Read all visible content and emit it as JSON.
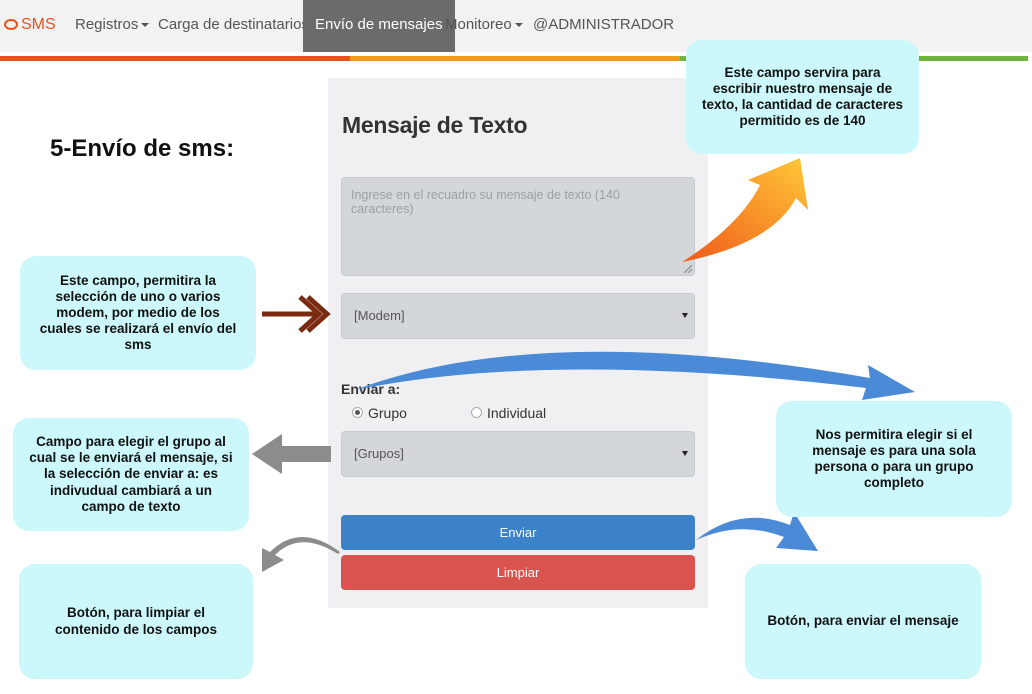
{
  "navbar": {
    "brand": "SMS",
    "items": [
      {
        "label": "Registros"
      },
      {
        "label": "Carga de destinatarios"
      },
      {
        "label": "Envío de mensajes"
      },
      {
        "label": "Monitoreo"
      },
      {
        "label": "@ADMINISTRADOR"
      }
    ],
    "active": "Envío de mensajes",
    "stripe_colors": [
      "#e8531c",
      "#f29a1e",
      "#6cb33f"
    ]
  },
  "heading": "5-Envío de sms:",
  "form": {
    "title": "Mensaje de Texto",
    "message_placeholder": "Ingrese en el recuadro su mensaje de texto (140 caracteres)",
    "modem_select": "[Modem]",
    "send_to_label": "Enviar a:",
    "radio_group": "Grupo",
    "radio_individual": "Individual",
    "radio_selected": "Grupo",
    "groups_select": "[Grupos]",
    "send_button": "Enviar",
    "clear_button": "Limpiar"
  },
  "callouts": {
    "message_field": "Este campo servira para escribir nuestro mensaje de texto, la cantidad de caracteres permitido es de 140",
    "modem_field": "Este campo, permitira la selección de uno o varios modem, por medio de los cuales se realizará el envío del sms",
    "send_to": "Nos permitira elegir si el mensaje es para una sola persona o para un grupo completo",
    "group_field": "Campo para elegir el grupo al cual se le enviará el mensaje, si la selección de enviar a: es indivudual cambiará a un campo de texto",
    "clear_button": "Botón, para limpiar el contenido de los campos",
    "send_button": "Botón, para enviar el mensaje"
  },
  "colors": {
    "accent": "#e8531c",
    "send": "#3b82c9",
    "clear": "#d9534f",
    "callout_bg": "#ccf8fb"
  }
}
